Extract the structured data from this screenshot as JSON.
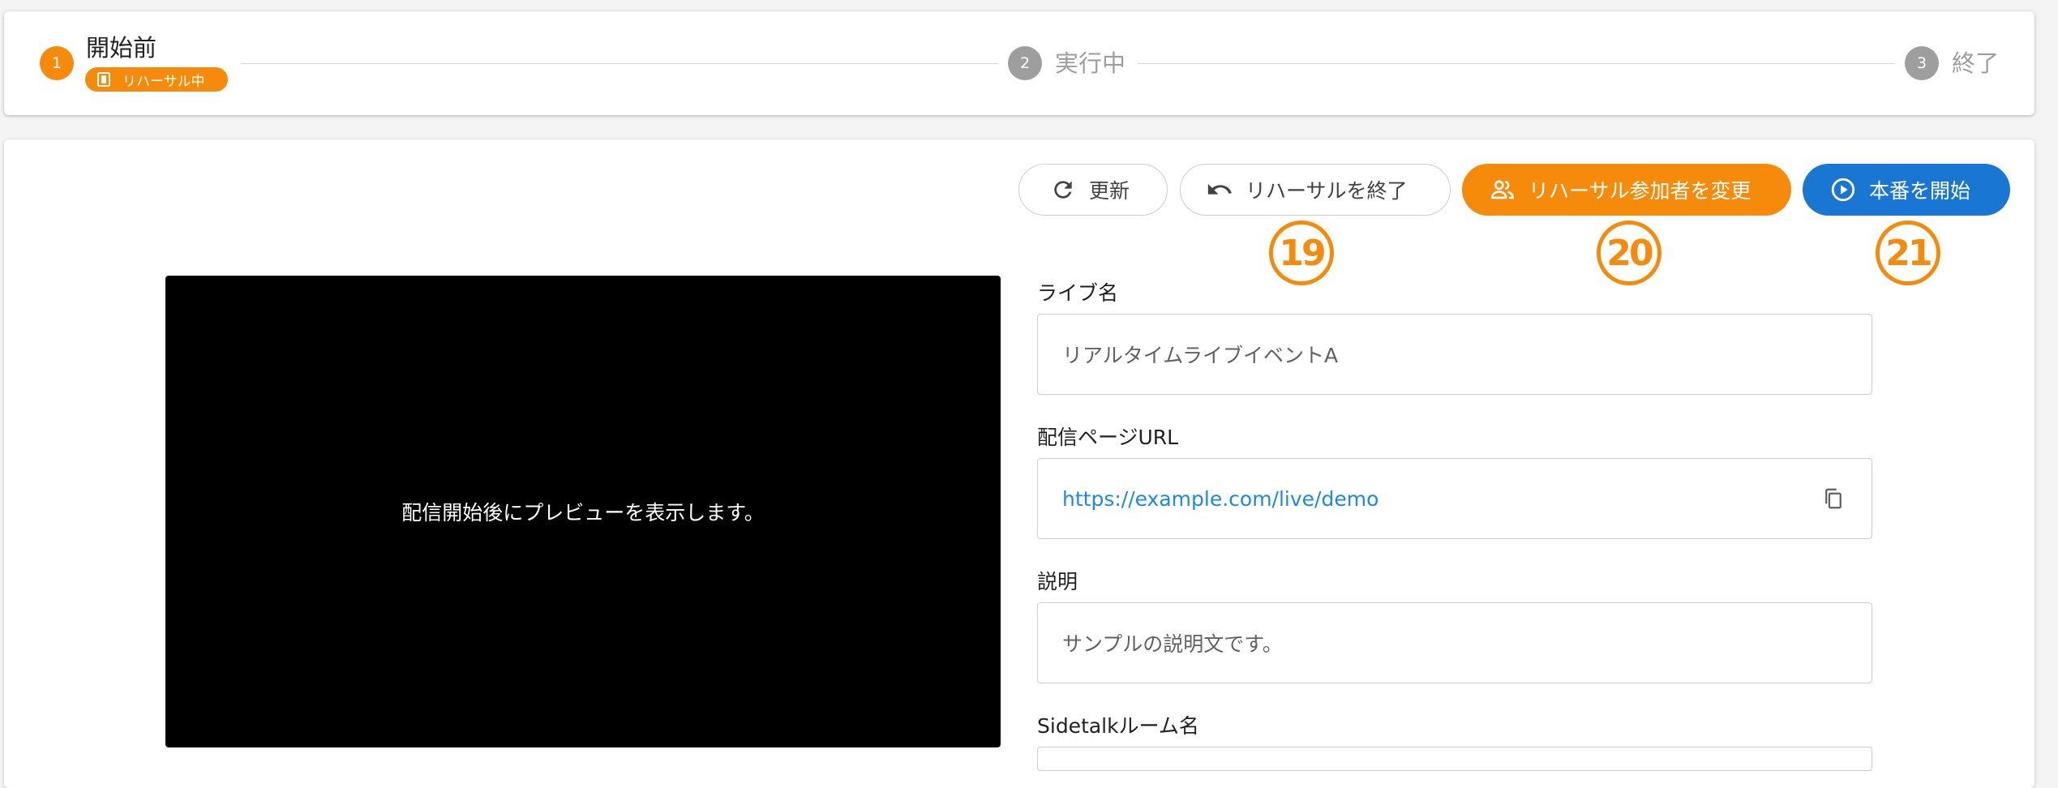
{
  "stepper": {
    "steps": [
      {
        "number": "1",
        "label": "開始前",
        "state": "active"
      },
      {
        "number": "2",
        "label": "実行中",
        "state": "inactive"
      },
      {
        "number": "3",
        "label": "終了",
        "state": "inactive"
      }
    ],
    "chip_label": "リハーサル中"
  },
  "toolbar": {
    "refresh_label": "更新",
    "end_rehearsal_label": "リハーサルを終了",
    "change_participants_label": "リハーサル参加者を変更",
    "start_live_label": "本番を開始"
  },
  "callouts": [
    "19",
    "20",
    "21"
  ],
  "preview": {
    "message": "配信開始後にプレビューを表示します。"
  },
  "form": {
    "live_name": {
      "label": "ライブ名",
      "value": "リアルタイムライブイベントA"
    },
    "page_url": {
      "label": "配信ページURL",
      "value": "https://example.com/live/demo"
    },
    "description": {
      "label": "説明",
      "value": "サンプルの説明文です。"
    },
    "sidetalk": {
      "label": "Sidetalkルーム名",
      "value": ""
    }
  },
  "colors": {
    "accent_orange": "#f68a0a",
    "primary_blue": "#1976d2",
    "link_blue": "#1e88e5",
    "inactive_gray": "#9e9e9e"
  }
}
